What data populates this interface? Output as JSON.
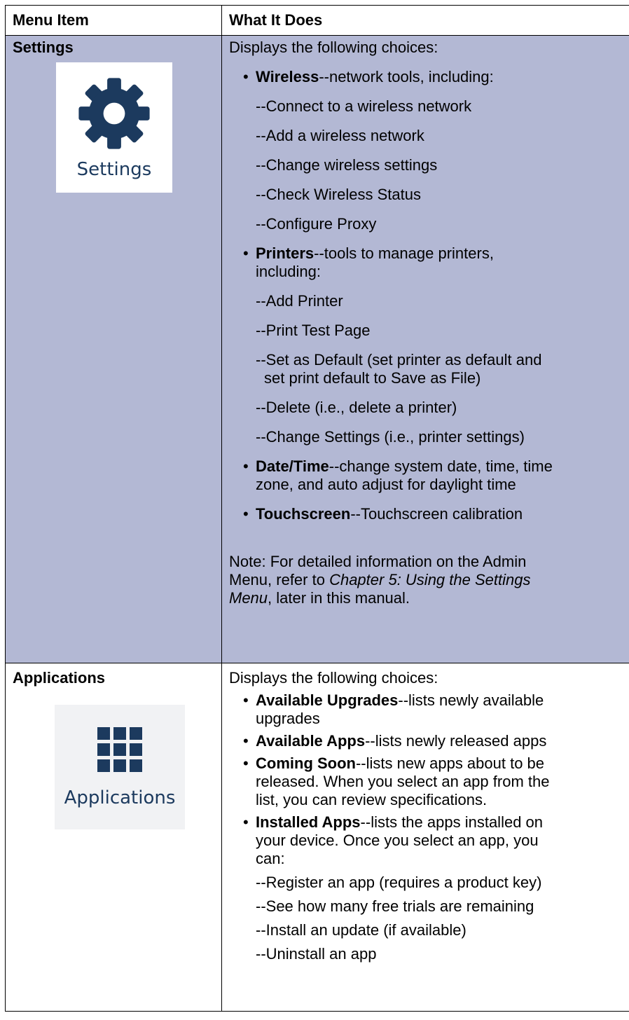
{
  "table": {
    "header": {
      "col1": "Menu Item",
      "col2": "What It Does"
    },
    "settings": {
      "label": "Settings",
      "icon_caption": "Settings",
      "icon": "gear-icon",
      "intro": "Displays the following choices:",
      "wireless": {
        "title": "Wireless",
        "desc": "--network tools, including:",
        "items": [
          "--Connect to a wireless network",
          "--Add a wireless network",
          "--Change wireless settings",
          "--Check Wireless Status",
          "--Configure Proxy"
        ]
      },
      "printers": {
        "title": "Printers",
        "desc_line1": "--tools to manage printers,",
        "desc_line2": "including:",
        "items": [
          "--Add Printer",
          "--Print Test Page"
        ],
        "default_line1": "--Set as Default (set printer as default and",
        "default_line2": "set print default to Save as File)",
        "items2": [
          "--Delete (i.e., delete a printer)",
          "--Change Settings (i.e., printer settings)"
        ]
      },
      "datetime": {
        "title": "Date/Time",
        "desc_line1": "--change system date, time, time",
        "desc_line2": "zone, and auto adjust for daylight time"
      },
      "touchscreen": {
        "title": "Touchscreen",
        "desc": "--Touchscreen calibration"
      },
      "note": {
        "line1": "Note: For detailed information on the Admin",
        "line2_prefix": "Menu, refer to ",
        "line2_italic": "Chapter 5: Using the Settings",
        "line3_italic": "Menu",
        "line3_suffix": ", later in this manual."
      }
    },
    "applications": {
      "label": "Applications",
      "icon_caption": "Applications",
      "icon": "grid-icon",
      "intro": "Displays the following choices:",
      "upgrades": {
        "title": "Available Upgrades",
        "desc_line1": "--lists newly available",
        "desc_line2": "upgrades"
      },
      "apps": {
        "title": "Available Apps",
        "desc": "--lists newly released apps"
      },
      "soon": {
        "title": "Coming Soon",
        "desc_line1": "--lists new apps about to be",
        "desc_line2": "released. When you select an app from the",
        "desc_line3": "list, you can review specifications."
      },
      "installed": {
        "title": "Installed Apps",
        "desc_line1": "--lists the apps installed on",
        "desc_line2": "your device. Once you select an app, you",
        "desc_line3": "can:",
        "items": [
          "--Register an app (requires a product key)",
          "--See how many free trials are remaining",
          "--Install an update (if available)",
          "--Uninstall an app"
        ]
      }
    }
  }
}
